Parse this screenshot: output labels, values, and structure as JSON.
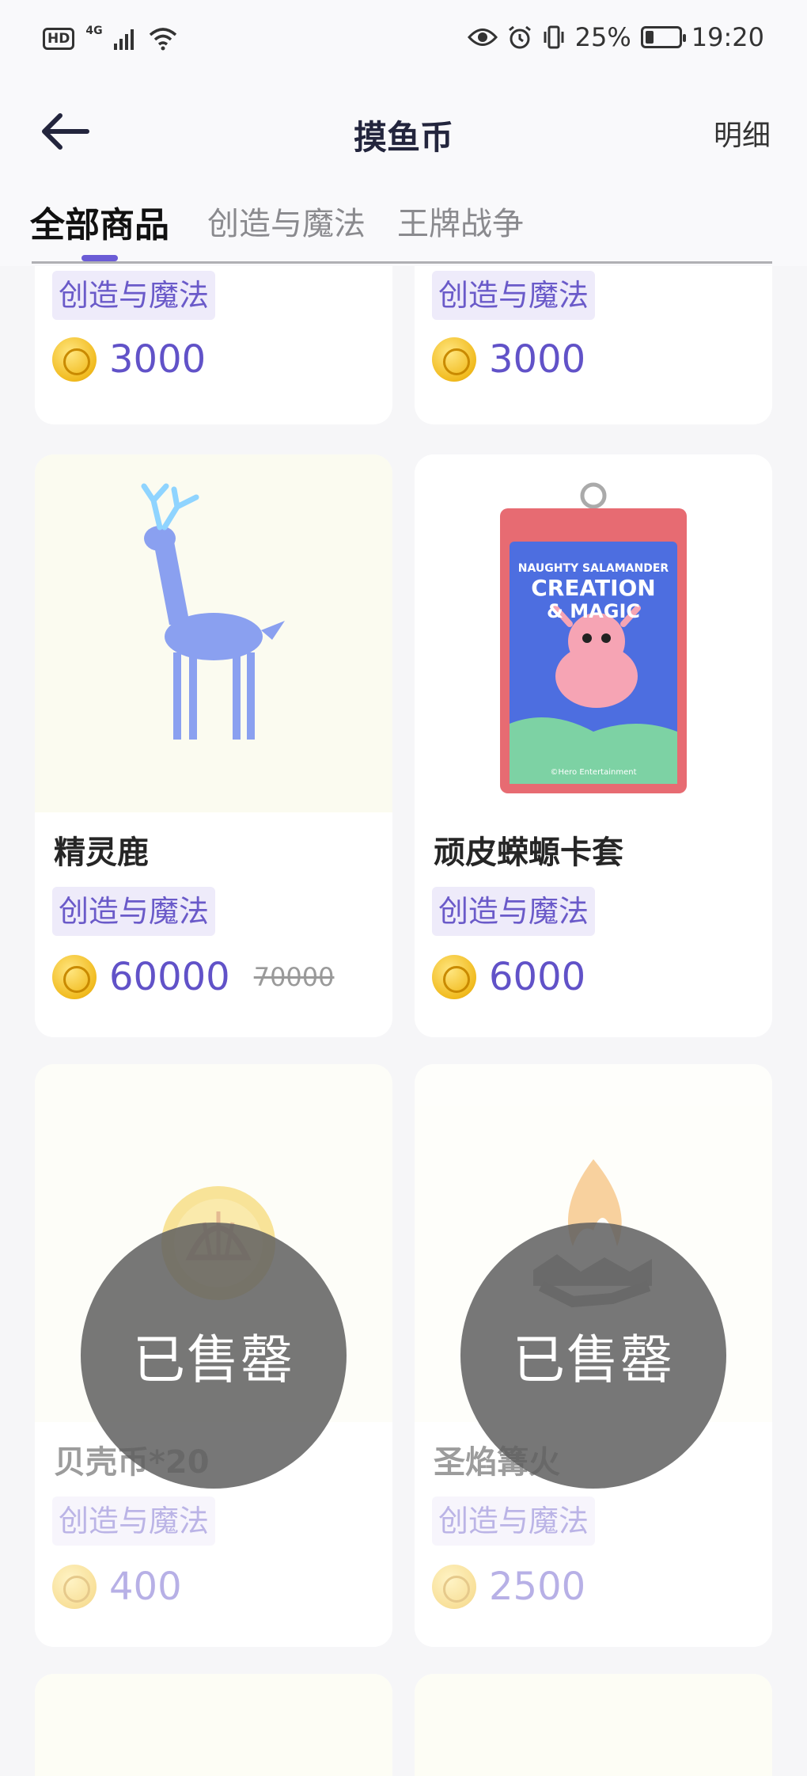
{
  "status": {
    "hd": "HD",
    "network": "4G",
    "battery": "25%",
    "battery_level": 0.25,
    "time": "19:20"
  },
  "nav": {
    "title": "摸鱼币",
    "detail": "明细"
  },
  "tabs": [
    {
      "label": "全部商品",
      "active": true
    },
    {
      "label": "创造与魔法",
      "active": false
    },
    {
      "label": "王牌战争",
      "active": false
    }
  ],
  "products": [
    {
      "name": "",
      "tag": "创造与魔法",
      "price": "3000",
      "old_price": "",
      "sold_out": false
    },
    {
      "name": "",
      "tag": "创造与魔法",
      "price": "3000",
      "old_price": "",
      "sold_out": false
    },
    {
      "name": "精灵鹿",
      "tag": "创造与魔法",
      "price": "60000",
      "old_price": "70000",
      "sold_out": false
    },
    {
      "name": "顽皮蝾螈卡套",
      "tag": "创造与魔法",
      "price": "6000",
      "old_price": "",
      "sold_out": false
    },
    {
      "name": "贝壳币*20",
      "tag": "创造与魔法",
      "price": "400",
      "old_price": "",
      "sold_out": true
    },
    {
      "name": "圣焰篝火",
      "tag": "创造与魔法",
      "price": "2500",
      "old_price": "",
      "sold_out": true
    }
  ],
  "soldout_label": "已售罄",
  "cardholder_print": {
    "line1": "NAUGHTY SALAMANDER",
    "line2": "CREATION",
    "line3": "& MAGIC",
    "footer": "©Hero Entertainment"
  },
  "colors": {
    "accent": "#6152c8",
    "tag_bg": "#eeebfa",
    "background": "#f6f6f8"
  }
}
